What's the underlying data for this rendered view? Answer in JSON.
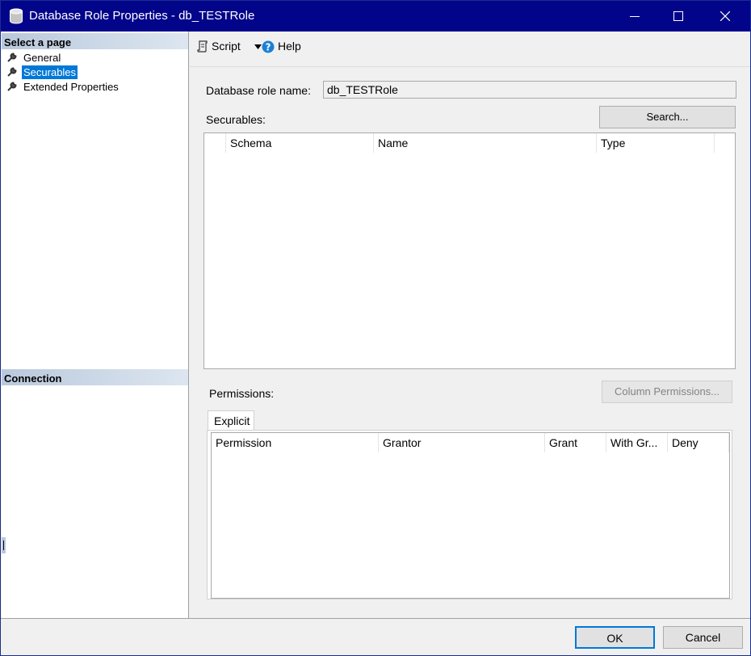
{
  "window": {
    "title": "Database Role Properties - db_TESTRole"
  },
  "left_pane": {
    "select_page_header": "Select a page",
    "pages": [
      {
        "label": "General",
        "selected": false
      },
      {
        "label": "Securables",
        "selected": true
      },
      {
        "label": "Extended Properties",
        "selected": false
      }
    ],
    "connection_header": "Connection"
  },
  "toolbar": {
    "script_label": "Script",
    "help_label": "Help"
  },
  "form": {
    "role_name_label": "Database role name:",
    "role_name_value": "db_TESTRole",
    "securables_label": "Securables:",
    "search_button": "Search...",
    "securables_columns": [
      "Schema",
      "Name",
      "Type"
    ],
    "permissions_label": "Permissions:",
    "column_permissions_button": "Column Permissions...",
    "tab_label": "Explicit",
    "permissions_columns": [
      "Permission",
      "Grantor",
      "Grant",
      "With Gr...",
      "Deny"
    ]
  },
  "footer": {
    "ok_label": "OK",
    "cancel_label": "Cancel"
  },
  "colors": {
    "titlebar": "#02048a",
    "selection": "#0078d7",
    "pane_header": "#b9c9dc",
    "help_icon": "#1a7fd4"
  }
}
